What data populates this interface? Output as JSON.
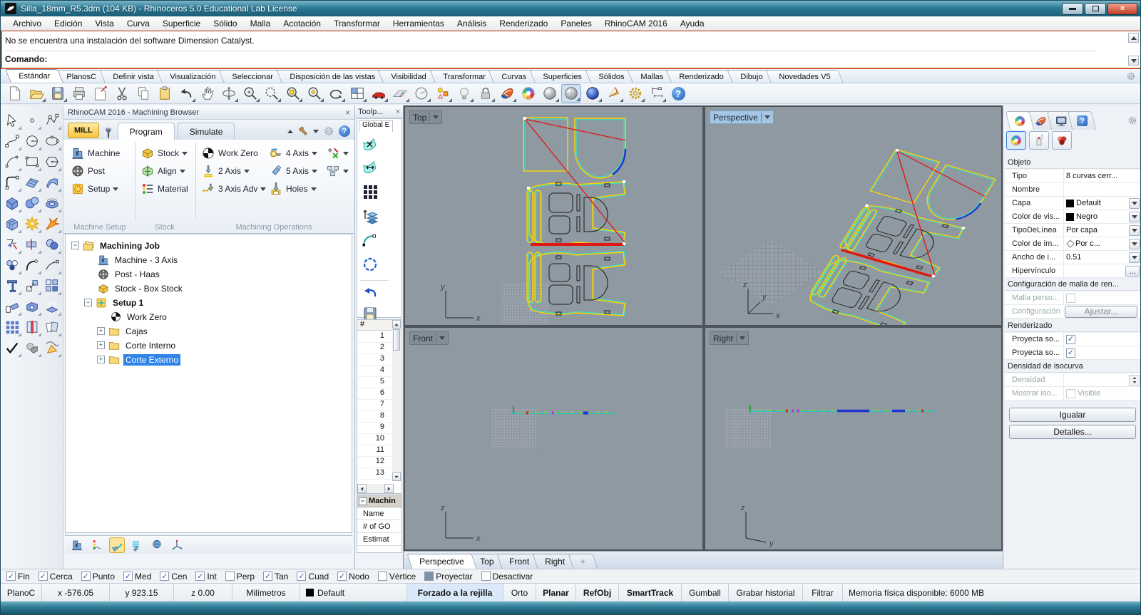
{
  "window": {
    "title": "Silla_18mm_R5.3dm (104 KB) - Rhinoceros 5.0 Educational Lab License"
  },
  "icons": {
    "close": "×",
    "help": "?",
    "plus": "+",
    "minus": "−",
    "check": "✓",
    "ellipsis": "..."
  },
  "menu": {
    "items": [
      "Archivo",
      "Edición",
      "Vista",
      "Curva",
      "Superficie",
      "Sólido",
      "Malla",
      "Acotación",
      "Transformar",
      "Herramientas",
      "Análisis",
      "Renderizado",
      "Paneles",
      "RhinoCAM 2016",
      "Ayuda"
    ]
  },
  "command": {
    "message": "No se encuentra una instalación del software Dimension Catalyst.",
    "prompt": "Comando:"
  },
  "tab_groups": {
    "items": [
      "Estándar",
      "PlanosC",
      "Definir vista",
      "Visualización",
      "Seleccionar",
      "Disposición de las vistas",
      "Visibilidad",
      "Transformar",
      "Curvas",
      "Superficies",
      "Sólidos",
      "Mallas",
      "Renderizado",
      "Dibujo",
      "Novedades V5"
    ]
  },
  "browser": {
    "title": "RhinoCAM 2016 - Machining Browser",
    "mill": "MILL",
    "tab_program": "Program",
    "tab_simulate": "Simulate",
    "machine": "Machine",
    "post": "Post",
    "setup": "Setup",
    "stock": "Stock",
    "align": "Align",
    "material": "Material",
    "work_zero": "Work Zero",
    "axis2": "2 Axis",
    "axis3": "3 Axis Adv",
    "axis4": "4 Axis",
    "axis5": "5 Axis",
    "holes": "Holes",
    "group1": "Machine Setup",
    "group2": "Stock",
    "group3": "Machining Operations",
    "tree": {
      "job": "Machining Job",
      "machine": "Machine - 3 Axis",
      "post": "Post - Haas",
      "stock": "Stock - Box Stock",
      "setup": "Setup 1",
      "work_zero": "Work Zero",
      "cajas": "Cajas",
      "corte_interno": "Corte Interno",
      "corte_externo": "Corte Externo"
    }
  },
  "toolpath": {
    "title": "Toolp...",
    "tab": "Global E",
    "list_header": "#",
    "rows": [
      "1",
      "2",
      "3",
      "4",
      "5",
      "6",
      "7",
      "8",
      "9",
      "10",
      "11",
      "12",
      "13"
    ],
    "info_title": "Machin",
    "info_rows": [
      "Name",
      "# of GO",
      "Estimat"
    ]
  },
  "viewports": {
    "top": "Top",
    "perspective": "Perspective",
    "front": "Front",
    "right": "Right",
    "tabs": [
      "Perspective",
      "Top",
      "Front",
      "Right"
    ],
    "axes": {
      "x": "x",
      "y": "y",
      "z": "z"
    }
  },
  "props": {
    "s_obj": "Objeto",
    "tipo": "Tipo",
    "tipo_v": "8 curvas cerr...",
    "nombre": "Nombre",
    "capa": "Capa",
    "capa_v": "Default",
    "cvis": "Color de vis...",
    "cvis_v": "Negro",
    "tlinea": "TipoDeLínea",
    "tlinea_v": "Por capa",
    "cim": "Color de im...",
    "cim_v": "Por c...",
    "ancho": "Ancho de i...",
    "ancho_v": "0.51",
    "hiper": "Hipervínculo",
    "s_malla": "Configuración de malla de ren...",
    "malla": "Malla perso...",
    "config": "Configuración",
    "ajustar": "Ajustar...",
    "s_render": "Renderizado",
    "proy1": "Proyecta so...",
    "proy2": "Proyecta so...",
    "s_iso": "Densidad de isocurva",
    "densidad": "Densidad",
    "mostrar": "Mostrar iso...",
    "visible": "Visible",
    "igualar": "Igualar",
    "detalles": "Detalles..."
  },
  "osnap": {
    "fin": "Fin",
    "cerca": "Cerca",
    "punto": "Punto",
    "med": "Med",
    "cen": "Cen",
    "int": "Int",
    "perp": "Perp",
    "tan": "Tan",
    "cuad": "Cuad",
    "nodo": "Nodo",
    "vertice": "Vértice",
    "proyectar": "Proyectar",
    "desactivar": "Desactivar",
    "states": {
      "fin": "✓",
      "cerca": "✓",
      "punto": "✓",
      "med": "✓",
      "cen": "✓",
      "int": "✓",
      "perp": "",
      "tan": "✓",
      "cuad": "✓",
      "nodo": "✓",
      "vertice": "",
      "desactivar": ""
    }
  },
  "status": {
    "plane": "PlanoC",
    "x": "x -576.05",
    "y": "y 923.15",
    "z": "z 0.00",
    "units": "Milímetros",
    "layer": "Default",
    "grid_snap": "Forzado a la rejilla",
    "ortho": "Orto",
    "planar": "Planar",
    "refobj": "RefObj",
    "smarttrack": "SmartTrack",
    "gumball": "Gumball",
    "history": "Grabar historial",
    "filter": "Filtrar",
    "memory": "Memoria física disponible: 6000 MB"
  },
  "colors": {
    "selection": "#2f84e8",
    "mill_yellow": "#f7c341",
    "viewport_bg": "#8f99a2",
    "curve_yellow": "#ffd400",
    "toolpath_cyan": "#2ee8c8",
    "rapid_red": "#e01812",
    "titlebar": "#2d7b96"
  }
}
